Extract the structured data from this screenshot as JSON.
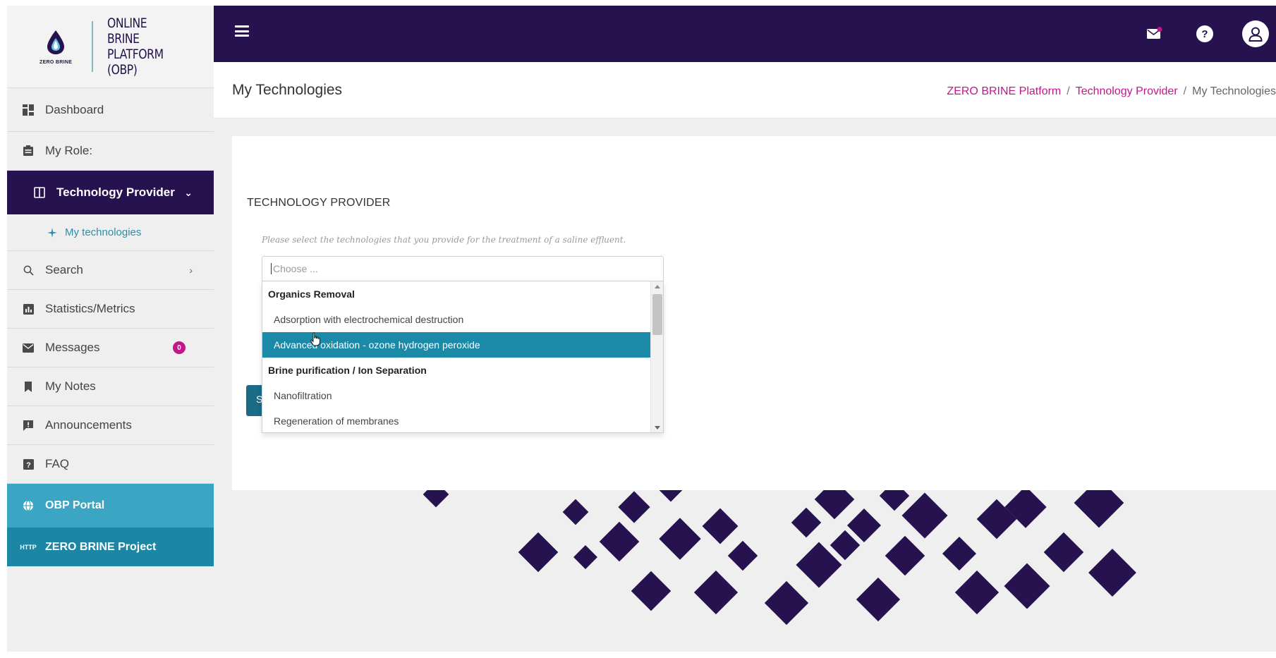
{
  "brand": {
    "logo_sub": "ZERO BRINE",
    "line1": "ONLINE",
    "line2": "BRINE",
    "line3": "PLATFORM (OBP)"
  },
  "colors": {
    "primary": "#26124f",
    "accent": "#c2178a",
    "teal": "#1a8aa8",
    "portal": "#3aa6c3",
    "project": "#1c86a5"
  },
  "sidebar": {
    "dashboard": "Dashboard",
    "my_role": "My Role:",
    "technology_provider": "Technology Provider",
    "my_technologies": "My technologies",
    "search": "Search",
    "statistics": "Statistics/Metrics",
    "messages": "Messages",
    "messages_count": "0",
    "my_notes": "My Notes",
    "announcements": "Announcements",
    "faq": "FAQ",
    "obp_portal": "OBP Portal",
    "zero_brine_project": "ZERO BRINE Project",
    "project_icon_text": "HTTP"
  },
  "header": {
    "icons": [
      "menu-icon",
      "mail-icon",
      "help-icon",
      "user-icon"
    ],
    "help_glyph": "?"
  },
  "page": {
    "title": "My Technologies",
    "breadcrumb": [
      "ZERO BRINE Platform",
      "Technology Provider",
      "My Technologies"
    ],
    "breadcrumb_sep": "/"
  },
  "form": {
    "section_title": "TECHNOLOGY PROVIDER",
    "helper": "Please select the technologies that you provide for the treatment of a saline effluent.",
    "placeholder": "Choose ...",
    "submit_label": "S",
    "dropdown": {
      "groups": [
        {
          "label": "Organics Removal",
          "options": [
            {
              "label": "Adsorption with electrochemical destruction",
              "highlighted": false
            },
            {
              "label": "Advanced oxidation - ozone hydrogen peroxide",
              "highlighted": true
            }
          ]
        },
        {
          "label": "Brine purification / Ion Separation",
          "options": [
            {
              "label": "Nanofiltration",
              "highlighted": false
            },
            {
              "label": "Regeneration of membranes",
              "highlighted": false
            }
          ]
        }
      ]
    }
  }
}
